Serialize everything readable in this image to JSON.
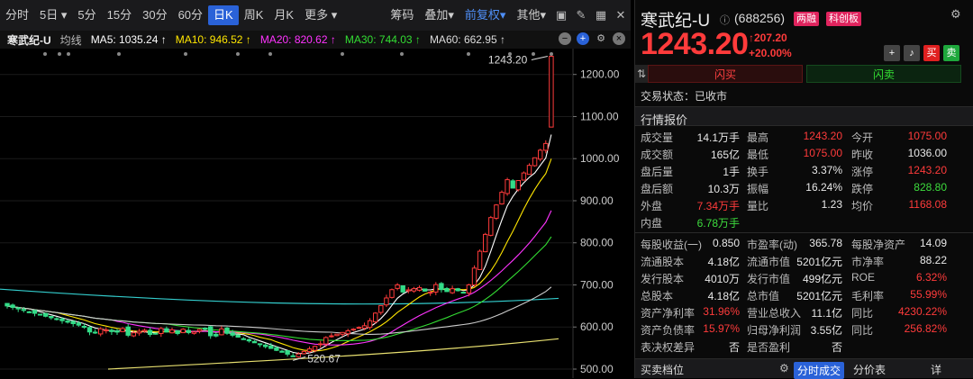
{
  "toolbar": {
    "items": [
      "分时",
      "5日",
      "5分",
      "15分",
      "30分",
      "60分",
      "日K",
      "周K",
      "月K",
      "更多"
    ],
    "dropdown_marks": [
      "▾",
      "▾"
    ],
    "right_items": [
      "筹码",
      "叠加",
      "前复权",
      "其他"
    ],
    "icons": [
      "fullscreen-icon",
      "pen-icon",
      "grid-icon",
      "close-icon"
    ]
  },
  "ma_bar": {
    "title": "寒武纪-U",
    "mode": "均线",
    "ma5": "MA5: 1035.24 ↑",
    "ma10": "MA10: 946.52 ↑",
    "ma20": "MA20: 820.62 ↑",
    "ma30": "MA30: 744.03 ↑",
    "ma60": "MA60: 662.95 ↑",
    "colors": {
      "ma5": "#ffffff",
      "ma10": "#ffe600",
      "ma20": "#ff33ff",
      "ma30": "#33dd33",
      "ma60": "#cccccc"
    }
  },
  "chart_data": {
    "type": "candlestick",
    "y_ticks": [
      "1200.00",
      "1100.00",
      "1000.00",
      "900.00",
      "800.00",
      "700.00",
      "600.00",
      "500.00"
    ],
    "ylim": [
      500,
      1240
    ],
    "high_label": "1243.20",
    "low_label": "520.67",
    "high_value": 1243.2,
    "low_value": 520.67
  },
  "quote": {
    "name": "寒武纪-U",
    "code": "(688256)",
    "tags": [
      "两融",
      "科创板"
    ],
    "price": "1243.20",
    "change": "↑207.20",
    "change_pct": "+20.00%",
    "buttons": [
      "+",
      "🔔",
      "买",
      "卖"
    ],
    "flash_buy": "闪买",
    "flash_sell": "闪卖",
    "status": "交易状态：已收市",
    "section_quote": "行情报价",
    "rows": [
      [
        [
          "成交量",
          "14.1万手",
          "wht"
        ],
        [
          "最高",
          "1243.20",
          "red"
        ],
        [
          "今开",
          "1075.00",
          "red"
        ]
      ],
      [
        [
          "成交额",
          "165亿",
          "wht"
        ],
        [
          "最低",
          "1075.00",
          "red"
        ],
        [
          "昨收",
          "1036.00",
          "wht"
        ]
      ],
      [
        [
          "盘后量",
          "1手",
          "wht"
        ],
        [
          "换手",
          "3.37%",
          "wht"
        ],
        [
          "涨停",
          "1243.20",
          "red"
        ]
      ],
      [
        [
          "盘后额",
          "10.3万",
          "wht"
        ],
        [
          "振幅",
          "16.24%",
          "wht"
        ],
        [
          "跌停",
          "828.80",
          "grn"
        ]
      ],
      [
        [
          "外盘",
          "7.34万手",
          "red"
        ],
        [
          "量比",
          "1.23",
          "wht"
        ],
        [
          "均价",
          "1168.08",
          "red"
        ]
      ],
      [
        [
          "内盘",
          "6.78万手",
          "grn"
        ],
        [
          "",
          "",
          " "
        ],
        [
          "",
          "",
          " "
        ]
      ]
    ],
    "rows2": [
      [
        [
          "每股收益(一)",
          "0.850",
          "wht"
        ],
        [
          "市盈率(动)",
          "365.78",
          "wht"
        ],
        [
          "每股净资产",
          "14.09",
          "wht"
        ]
      ],
      [
        [
          "流通股本",
          "4.18亿",
          "wht"
        ],
        [
          "流通市值",
          "5201亿元",
          "wht"
        ],
        [
          "市净率",
          "88.22",
          "wht"
        ]
      ],
      [
        [
          "发行股本",
          "4010万",
          "wht"
        ],
        [
          "发行市值",
          "499亿元",
          "wht"
        ],
        [
          "ROE",
          "6.32%",
          "red"
        ]
      ],
      [
        [
          "总股本",
          "4.18亿",
          "wht"
        ],
        [
          "总市值",
          "5201亿元",
          "wht"
        ],
        [
          "毛利率",
          "55.99%",
          "red"
        ]
      ],
      [
        [
          "资产净利率",
          "31.96%",
          "red"
        ],
        [
          "营业总收入",
          "11.1亿",
          "wht"
        ],
        [
          "同比",
          "4230.22%",
          "red"
        ]
      ],
      [
        [
          "资产负债率",
          "15.97%",
          "red"
        ],
        [
          "归母净利润",
          "3.55亿",
          "wht"
        ],
        [
          "同比",
          "256.82%",
          "red"
        ]
      ],
      [
        [
          "表决权差异",
          "否",
          "wht"
        ],
        [
          "是否盈利",
          "否",
          "wht"
        ],
        [
          "",
          "",
          " "
        ]
      ]
    ],
    "bottom": {
      "left": "买卖档位",
      "tab1": "分时成交",
      "tab2": "分价表",
      "detail": "详"
    }
  }
}
